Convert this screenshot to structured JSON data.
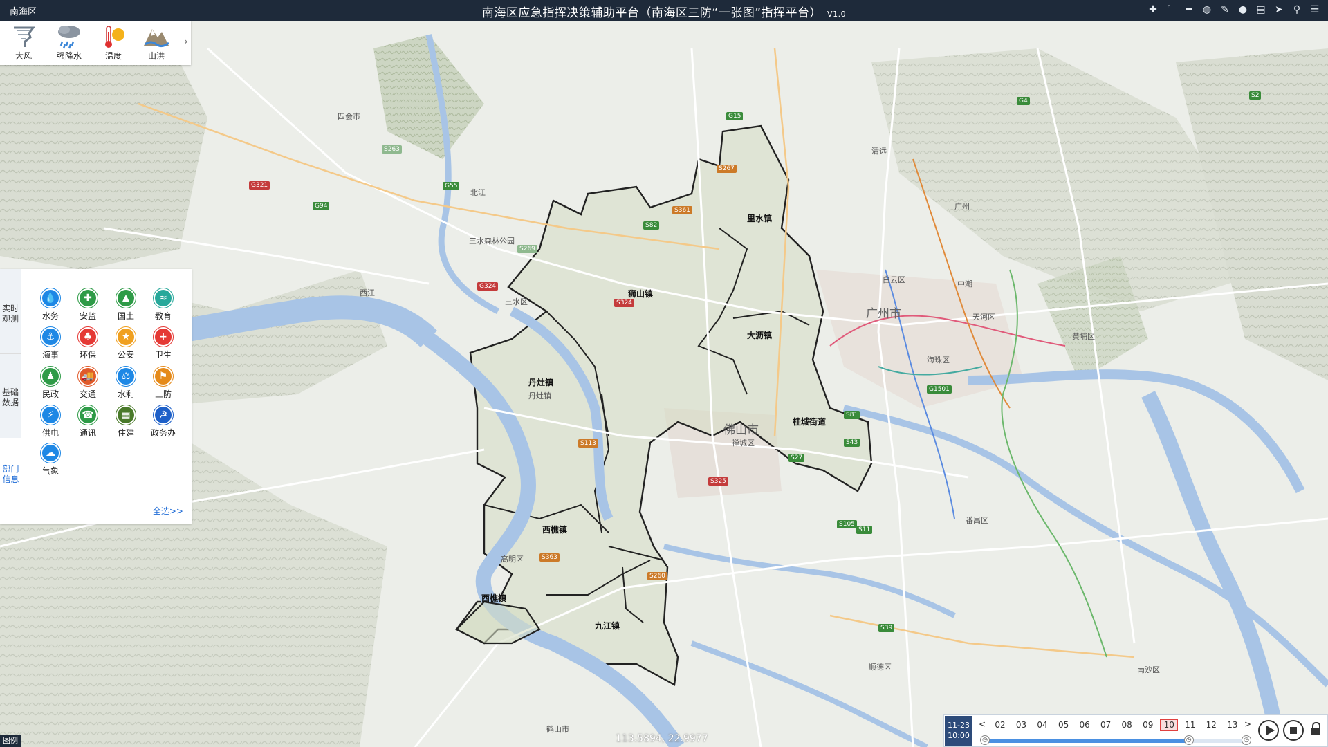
{
  "header": {
    "region": "南海区",
    "title": "南海区应急指挥决策辅助平台（南海区三防“一张图”指挥平台）",
    "version": "V1.0"
  },
  "toolbar_icons": [
    "plus-icon",
    "fullscreen-icon",
    "minus-icon",
    "globe-icon",
    "edit-icon",
    "drop-icon",
    "document-icon",
    "send-icon",
    "search-icon",
    "database-icon"
  ],
  "weather": {
    "items": [
      {
        "label": "大风",
        "icon": "wind-icon"
      },
      {
        "label": "强降水",
        "icon": "heavy-rain-icon"
      },
      {
        "label": "温度",
        "icon": "temperature-icon"
      },
      {
        "label": "山洪",
        "icon": "flash-flood-icon"
      }
    ],
    "next": "›"
  },
  "categories": {
    "tabs": [
      "实时观测",
      "基础数据",
      "部门信息"
    ],
    "items": [
      {
        "label": "水务",
        "icon": "water-affairs-icon",
        "color": "#1e88e5",
        "glyph": "💧"
      },
      {
        "label": "安监",
        "icon": "safety-icon",
        "color": "#2e9b47",
        "glyph": "✚"
      },
      {
        "label": "国土",
        "icon": "land-icon",
        "color": "#2e9b47",
        "glyph": "▲"
      },
      {
        "label": "教育",
        "icon": "education-icon",
        "color": "#27a89a",
        "glyph": "≈"
      },
      {
        "label": "海事",
        "icon": "maritime-icon",
        "color": "#1e88e5",
        "glyph": "⚓"
      },
      {
        "label": "环保",
        "icon": "environment-icon",
        "color": "#e53935",
        "glyph": "♣"
      },
      {
        "label": "公安",
        "icon": "police-icon",
        "color": "#f0a020",
        "glyph": "★"
      },
      {
        "label": "卫生",
        "icon": "health-icon",
        "color": "#e53935",
        "glyph": "+"
      },
      {
        "label": "民政",
        "icon": "civil-affairs-icon",
        "color": "#2e9b47",
        "glyph": "♟"
      },
      {
        "label": "交通",
        "icon": "traffic-icon",
        "color": "#e05a2a",
        "glyph": "🚚"
      },
      {
        "label": "水利",
        "icon": "water-conservancy-icon",
        "color": "#1e88e5",
        "glyph": "⚖"
      },
      {
        "label": "三防",
        "icon": "three-defense-icon",
        "color": "#e58a1a",
        "glyph": "⚑"
      },
      {
        "label": "供电",
        "icon": "power-icon",
        "color": "#1e88e5",
        "glyph": "⚡"
      },
      {
        "label": "通讯",
        "icon": "telecom-icon",
        "color": "#2e9b47",
        "glyph": "☎"
      },
      {
        "label": "住建",
        "icon": "housing-icon",
        "color": "#4a7a2a",
        "glyph": "▦"
      },
      {
        "label": "政务办",
        "icon": "government-icon",
        "color": "#1e60c8",
        "glyph": "☭"
      },
      {
        "label": "气象",
        "icon": "meteorology-icon",
        "color": "#1e88e5",
        "glyph": "☁"
      }
    ],
    "select_all": "全选>>"
  },
  "map": {
    "cities": [
      "广州市",
      "佛山市"
    ],
    "towns": [
      "里水镇",
      "狮山镇",
      "大沥镇",
      "丹灶镇",
      "桂城街道",
      "西樵镇",
      "九江镇",
      "西樵镇"
    ],
    "places": [
      "三水森林公园",
      "白云区",
      "中潮",
      "禅城区",
      "丹灶镇",
      "天河区",
      "黄埔区",
      "海珠区",
      "番禺区",
      "顺德区",
      "南沙区",
      "鹤山市",
      "高明区",
      "四会市",
      "三水区",
      "广州",
      "西江",
      "北江",
      "清远"
    ],
    "roads": [
      "G15",
      "G55",
      "G94",
      "S82",
      "S361",
      "S267",
      "S263",
      "S269",
      "G321",
      "G324",
      "S324",
      "S113",
      "S325",
      "S363",
      "G1501",
      "S105",
      "S39",
      "S27",
      "S43",
      "S81",
      "G4",
      "S2",
      "S260",
      "S11"
    ]
  },
  "legend": "图例",
  "coordinates": "113.5894, 22.9977",
  "timeline": {
    "date": "11-23",
    "time": "10:00",
    "prev": "<",
    "next": ">",
    "hours": [
      "02",
      "03",
      "04",
      "05",
      "06",
      "07",
      "08",
      "09",
      "10",
      "11",
      "12",
      "13"
    ],
    "active_hour": "10",
    "progress": 0.78
  }
}
